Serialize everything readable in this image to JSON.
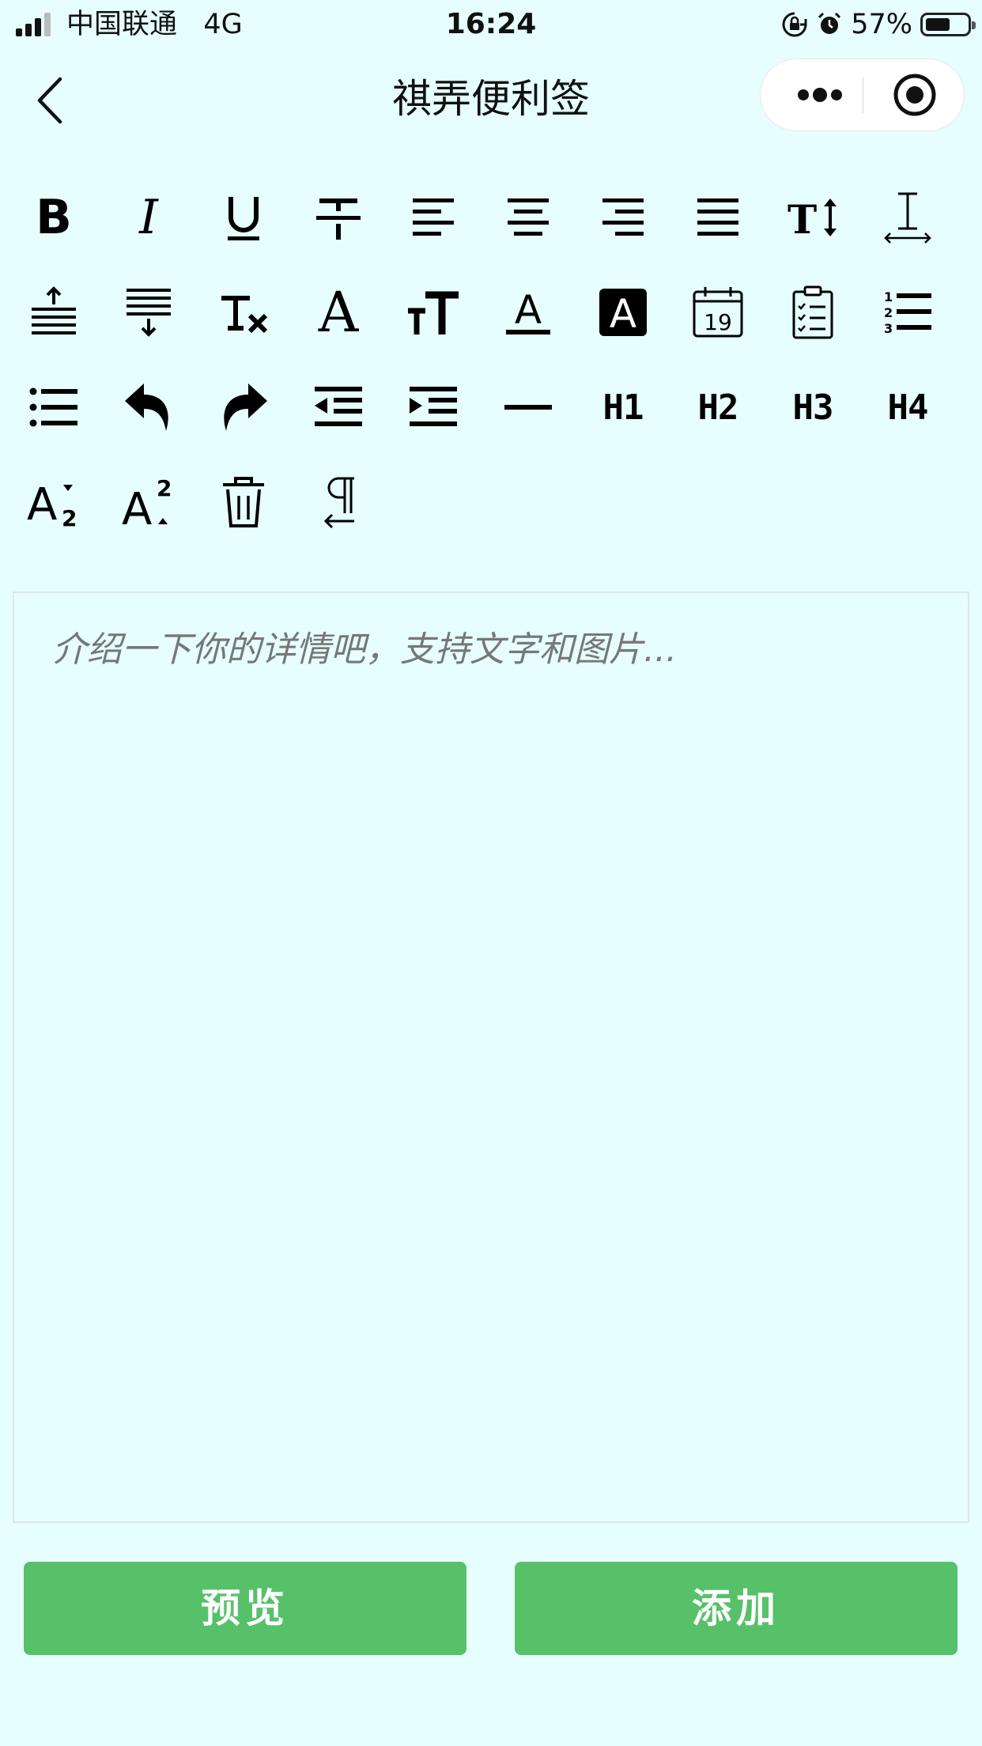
{
  "status_bar": {
    "carrier": "中国联通",
    "network": "4G",
    "time": "16:24",
    "battery": "57%"
  },
  "nav": {
    "title": "祺弄便利签"
  },
  "toolbar": {
    "rows": [
      [
        "bold",
        "italic",
        "underline",
        "strikethrough",
        "align-left",
        "align-center",
        "align-right",
        "align-justify",
        "line-height",
        "letter-spacing"
      ],
      [
        "margin-top",
        "margin-bottom",
        "remove-format",
        "font-family",
        "font-size",
        "font-color",
        "background-color",
        "date",
        "checklist",
        "ordered-list"
      ],
      [
        "bullet-list",
        "undo",
        "redo",
        "outdent",
        "indent",
        "horizontal-rule",
        "h1",
        "h2",
        "h3",
        "h4"
      ],
      [
        "subscript",
        "superscript",
        "clear",
        "direction"
      ]
    ],
    "labels": {
      "bold": "B",
      "italic": "I",
      "underline": "U",
      "font_size": "T",
      "h1": "H1",
      "h2": "H2",
      "h3": "H3",
      "h4": "H4",
      "calendar_day": "19",
      "sub_a": "A",
      "sub_2": "2",
      "sup_a": "A",
      "sup_2": "2",
      "font_family": "A",
      "font_color": "A",
      "bg_color": "A",
      "line_height": "T"
    }
  },
  "editor": {
    "placeholder": "介绍一下你的详情吧，支持文字和图片..."
  },
  "buttons": {
    "preview": "预览",
    "add": "添加"
  },
  "colors": {
    "background": "#e6fefe",
    "button": "#57c16a"
  }
}
